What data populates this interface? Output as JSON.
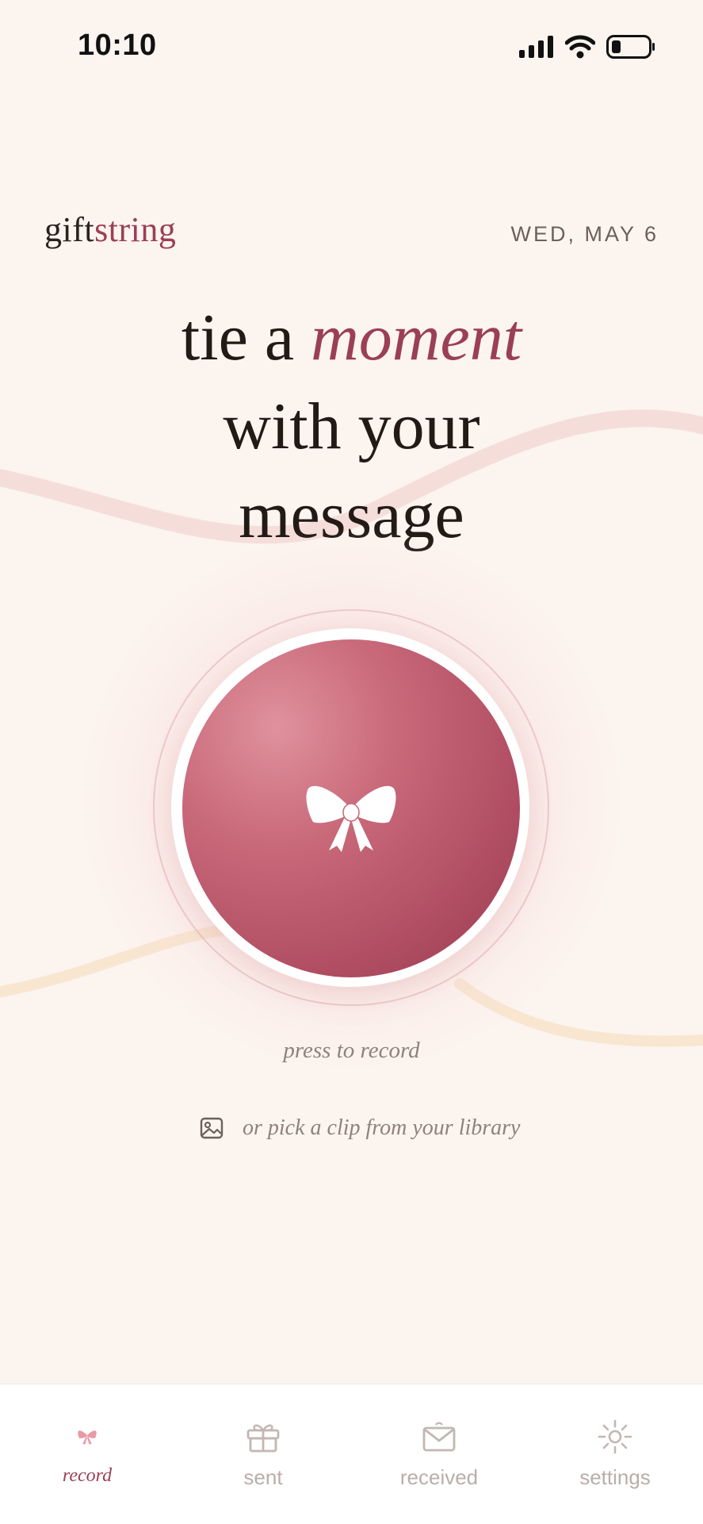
{
  "status_bar": {
    "time": "10:10"
  },
  "header": {
    "logo_part1": "gift",
    "logo_part2": "string",
    "date": "WED, MAY 6"
  },
  "headline": {
    "line1_pre": "tie a ",
    "line1_accent": "moment",
    "line2": "with your",
    "line3": "message"
  },
  "recorder": {
    "button_icon": "bow-icon",
    "press_label": "press to record",
    "library_icon": "image-icon",
    "library_label": "or pick a clip from your library"
  },
  "tabbar": {
    "active": "record",
    "tabs": [
      {
        "id": "record",
        "label": "record",
        "icon": "bow-icon"
      },
      {
        "id": "sent",
        "label": "sent",
        "icon": "gift-icon"
      },
      {
        "id": "received",
        "label": "received",
        "icon": "mail-icon"
      },
      {
        "id": "settings",
        "label": "settings",
        "icon": "sun-icon"
      }
    ]
  },
  "colors": {
    "background": "#fcf4ef",
    "accent": "#9a3f56",
    "record_button": "#b14e63",
    "muted_text": "#8f817b"
  }
}
